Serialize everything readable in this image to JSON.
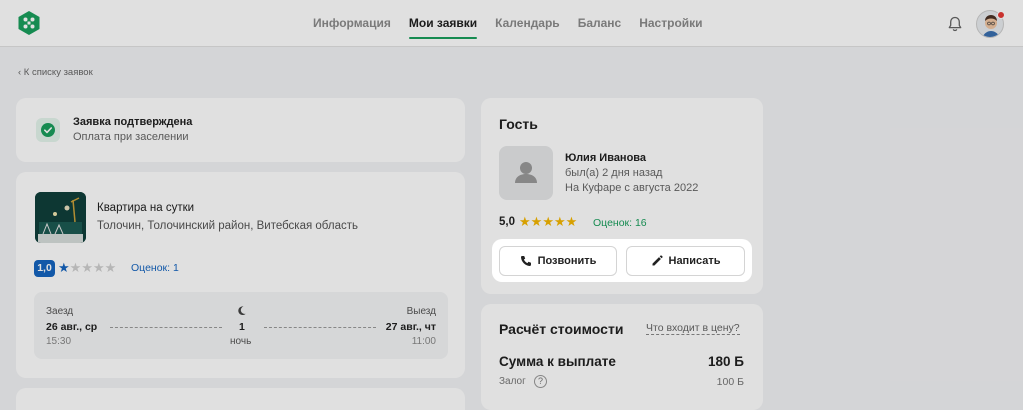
{
  "nav": {
    "items": [
      "Информация",
      "Мои заявки",
      "Календарь",
      "Баланс",
      "Настройки"
    ],
    "active_index": 1
  },
  "back_link": "‹  К списку заявок",
  "status": {
    "title": "Заявка подтверждена",
    "subtitle": "Оплата при заселении"
  },
  "apartment": {
    "title": "Квартира на сутки",
    "address": "Толочин, Толочинский район, Витебская область",
    "rating": "1,0",
    "stars": "★☆☆☆☆",
    "reviews": "Оценок: 1"
  },
  "dates": {
    "checkin_label": "Заезд",
    "checkin_date": "26 авг., ср",
    "checkin_time": "15:30",
    "nights_count": "1",
    "nights_label": "ночь",
    "checkout_label": "Выезд",
    "checkout_date": "27 авг., чт",
    "checkout_time": "11:00"
  },
  "guest": {
    "heading": "Гость",
    "name": "Юлия Иванова",
    "last_seen": "был(а) 2 дня назад",
    "member_since": "На Куфаре с августа 2022",
    "score": "5,0",
    "stars": "★★★★★",
    "reviews": "Оценок: 16",
    "call_label": "Позвонить",
    "write_label": "Написать"
  },
  "price": {
    "heading": "Расчёт стоимости",
    "whats_included": "Что входит в цену?",
    "total_label": "Сумма к выплате",
    "total_value": "180 Б",
    "deposit_label": "Залог",
    "deposit_help": "?",
    "deposit_value": "100 Б"
  },
  "colors": {
    "brand_green": "#1a9f5d",
    "star_yellow": "#f5b700",
    "rating_blue": "#1565c0"
  }
}
